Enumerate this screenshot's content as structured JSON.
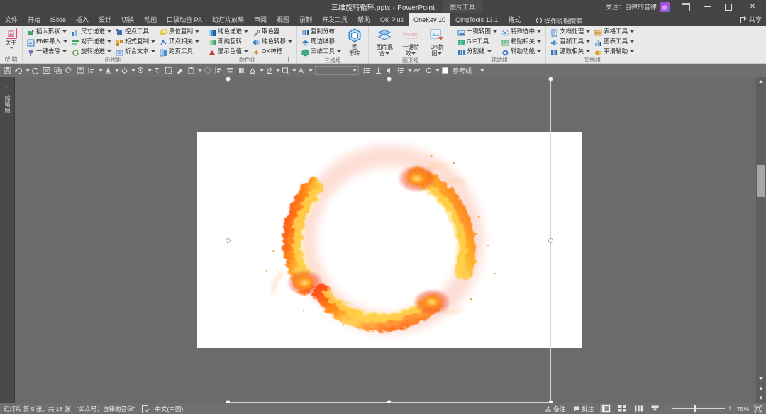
{
  "titlebar": {
    "document_title": "三维旋转循环.pptx  -  PowerPoint",
    "context_tab": "图片工具",
    "follow_text": "关注：自律的音律",
    "ribbon_display_icon": "ribbon-display-options-icon",
    "minimize_label": "minimize",
    "restore_label": "restore",
    "close_label": "✕"
  },
  "tabs": [
    {
      "label": "文件",
      "active": false
    },
    {
      "label": "开始",
      "active": false
    },
    {
      "label": "iSlide",
      "active": false
    },
    {
      "label": "插入",
      "active": false
    },
    {
      "label": "设计",
      "active": false
    },
    {
      "label": "切换",
      "active": false
    },
    {
      "label": "动画",
      "active": false
    },
    {
      "label": "口袋动画 PA",
      "active": false
    },
    {
      "label": "幻灯片放映",
      "active": false
    },
    {
      "label": "审阅",
      "active": false
    },
    {
      "label": "视图",
      "active": false
    },
    {
      "label": "录制",
      "active": false
    },
    {
      "label": "开发工具",
      "active": false
    },
    {
      "label": "帮助",
      "active": false
    },
    {
      "label": "OK Plus",
      "active": false
    },
    {
      "label": "OneKey 10",
      "active": true
    },
    {
      "label": "QingTools 13.1",
      "active": false
    },
    {
      "label": "格式",
      "active": false
    }
  ],
  "tellme": {
    "label": "操作说明搜索",
    "icon": "lightbulb-icon"
  },
  "share": {
    "label": "共享",
    "icon": "share-icon"
  },
  "ribbon": {
    "about_group": {
      "button_label": "关于",
      "group_label": "帮 助",
      "icon_text": "囚"
    },
    "groups": [
      {
        "label": "形状组",
        "has_dialog_launcher": false,
        "columns": [
          {
            "items": [
              {
                "label": "插入形状",
                "icon": "insert-shape-icon",
                "caret": true,
                "color": "#2f9e4f"
              },
              {
                "label": "EMF导入",
                "icon": "emf-import-icon",
                "caret": true,
                "color": "#3a7bbf"
              },
              {
                "label": "一键去除",
                "icon": "one-click-remove-icon",
                "caret": true,
                "color": "#7b5ea7"
              }
            ]
          },
          {
            "items": [
              {
                "label": "尺寸递进",
                "icon": "size-progression-icon",
                "caret": true,
                "color": "#3a7bbf"
              },
              {
                "label": "对齐递进",
                "icon": "align-progression-icon",
                "caret": true,
                "color": "#2f9e4f"
              },
              {
                "label": "旋转递进",
                "icon": "rotate-progression-icon",
                "caret": true,
                "color": "#4f9f3c"
              }
            ]
          },
          {
            "items": [
              {
                "label": "控点工具",
                "icon": "handle-tool-icon",
                "caret": false,
                "color": "#3c6fb0"
              },
              {
                "label": "矩式复制",
                "icon": "matrix-copy-icon",
                "caret": true,
                "color": "#c98b2a"
              },
              {
                "label": "折合文本",
                "icon": "fold-text-icon",
                "caret": true,
                "color": "#5b86c9"
              }
            ]
          },
          {
            "items": [
              {
                "label": "原位复制",
                "icon": "in-place-copy-icon",
                "caret": true,
                "color": "#d8b93c"
              },
              {
                "label": "顶点相关",
                "icon": "vertex-related-icon",
                "caret": true,
                "color": "#2f7fc4"
              },
              {
                "label": "跨页工具",
                "icon": "cross-page-tool-icon",
                "caret": false,
                "color": "#4f8dd0"
              }
            ]
          }
        ]
      },
      {
        "label": "颜色组",
        "has_dialog_launcher": true,
        "columns": [
          {
            "items": [
              {
                "label": "纯色递进",
                "icon": "solid-color-progression-icon",
                "caret": true,
                "color": "#3a9ad9"
              },
              {
                "label": "渐纯互转",
                "icon": "gradient-solid-convert-icon",
                "caret": false,
                "color": "#45a06b"
              },
              {
                "label": "显示色值",
                "icon": "show-color-value-icon",
                "caret": true,
                "color": "#c0392b"
              }
            ]
          },
          {
            "items": [
              {
                "label": "取色器",
                "icon": "eyedropper-icon",
                "caret": false,
                "color": "#6f6f6f"
              },
              {
                "label": "纯色转移",
                "icon": "color-transfer-icon",
                "caret": true,
                "color": "#3a7bbf"
              },
              {
                "label": "OK神框",
                "icon": "ok-magic-box-icon",
                "caret": false,
                "color": "#e08a2e"
              }
            ]
          }
        ]
      },
      {
        "label": "三维组",
        "has_dialog_launcher": false,
        "columns": [
          {
            "items": [
              {
                "label": "复制分布",
                "icon": "copy-distribute-icon",
                "caret": false,
                "color": "#3a7bbf"
              },
              {
                "label": "周边堆移",
                "icon": "surround-stack-icon",
                "caret": false,
                "color": "#2f7fc4"
              },
              {
                "label": "三维工具",
                "icon": "three-d-tool-icon",
                "caret": true,
                "color": "#2f9e7f"
              }
            ]
          }
        ],
        "big_buttons": [
          {
            "label_line1": "图",
            "label_line2": "形库",
            "icon": "shape-library-icon",
            "caret": false
          }
        ]
      },
      {
        "label": "图形组",
        "has_dialog_launcher": false,
        "big_buttons": [
          {
            "label_line1": "图片混",
            "label_line2": "合",
            "icon": "picture-blend-icon",
            "caret": true
          },
          {
            "label_line1": "一键特",
            "label_line2": "效",
            "icon": "one-click-effect-icon",
            "caret": true
          },
          {
            "label_line1": "OK拼",
            "label_line2": "图",
            "icon": "ok-collage-icon",
            "caret": true
          }
        ],
        "columns": []
      },
      {
        "label": "辅助组",
        "has_dialog_launcher": false,
        "columns": [
          {
            "items": [
              {
                "label": "一键转图",
                "icon": "one-click-to-image-icon",
                "caret": true,
                "color": "#3a7bbf"
              },
              {
                "label": "GIF工具",
                "icon": "gif-tool-icon",
                "caret": false,
                "color": "#2f9e7f"
              },
              {
                "label": "分割线",
                "icon": "divider-line-icon",
                "caret": true,
                "color": "#3a7bbf"
              }
            ]
          },
          {
            "items": [
              {
                "label": "特殊选中",
                "icon": "special-select-icon",
                "caret": true,
                "color": "#4f8dd0"
              },
              {
                "label": "粘贴相关",
                "icon": "paste-related-icon",
                "caret": true,
                "color": "#45a06b"
              },
              {
                "label": "辅助功能",
                "icon": "accessibility-icon",
                "caret": true,
                "color": "#5b86c9"
              }
            ]
          }
        ]
      },
      {
        "label": "文档组",
        "has_dialog_launcher": false,
        "columns": [
          {
            "items": [
              {
                "label": "文档处理",
                "icon": "document-process-icon",
                "caret": true,
                "color": "#3a7bbf"
              },
              {
                "label": "音频工具",
                "icon": "audio-tool-icon",
                "caret": true,
                "color": "#4a8fd0"
              },
              {
                "label": "源数相关",
                "icon": "source-data-icon",
                "caret": true,
                "color": "#3a7bbf"
              }
            ]
          },
          {
            "items": [
              {
                "label": "表格工具",
                "icon": "table-tool-icon",
                "caret": true,
                "color": "#d08a2e"
              },
              {
                "label": "图表工具",
                "icon": "chart-tool-icon",
                "caret": true,
                "color": "#3a7bbf"
              },
              {
                "label": "平滑辅助",
                "icon": "morph-assist-icon",
                "caret": true,
                "color": "#e0a52e"
              }
            ]
          }
        ]
      }
    ]
  },
  "toolbar2": {
    "icons": [
      "save-icon",
      "undo-icon",
      "redo-icon",
      "slide-sorter-icon",
      "duplicate-icon",
      "animation-painter-icon",
      "text-box-icon",
      "align-left-icon",
      "align-object-icon",
      "shape-fill-icon",
      "shape-outline-icon",
      "shape-effects-icon",
      "format-painter-icon",
      "group-icon",
      "eraser-icon",
      "clipboard-icon",
      "ellipse-icon",
      "merge-shapes-icon",
      "distribute-icon",
      "bold-icon",
      "font-color-icon",
      "highlight-icon",
      "edit-shape-icon",
      "font-size-icon"
    ],
    "combo_value": "",
    "icons_after": [
      "bullets-icon",
      "numbering-icon",
      "line-spacing-icon",
      "columns-icon",
      "paragraph-icon",
      "spelling-icon",
      "rotate-icon"
    ],
    "guide_label": "参考线",
    "guide_swatch_color": "#ffffff"
  },
  "left_rail": {
    "chevron": "›",
    "vertical_label": "缩略图"
  },
  "slide": {
    "picture_name": "fire-ring-picture",
    "selection_handles": 8
  },
  "statusbar": {
    "slide_count_text": "幻灯片 第 5 张，共 16 张",
    "presentation_note": "\"公众号：自律的音律\"",
    "proof_icon": "proofing-icon",
    "language": "中文(中国)",
    "notes_label": "备注",
    "comments_label": "批注",
    "view_normal_icon": "normal-view-icon",
    "view_sorter_icon": "slide-sorter-view-icon",
    "view_reading_icon": "reading-view-icon",
    "view_show_icon": "slideshow-view-icon",
    "zoom_out": "−",
    "zoom_in": "+",
    "zoom_level": "75%",
    "fit_icon": "fit-to-window-icon"
  },
  "colors": {
    "title_bar": "#444444",
    "ribbon_bg": "#e9e9e9",
    "canvas_bg": "#6b6b6b",
    "slide_bg": "#ffffff",
    "status_bg": "#6f6f6f",
    "accent_active_tab": "#e8e8e8",
    "fire_orange": "#ff7a18",
    "fire_yellow": "#ffd24a",
    "fire_red": "#e8391b"
  }
}
